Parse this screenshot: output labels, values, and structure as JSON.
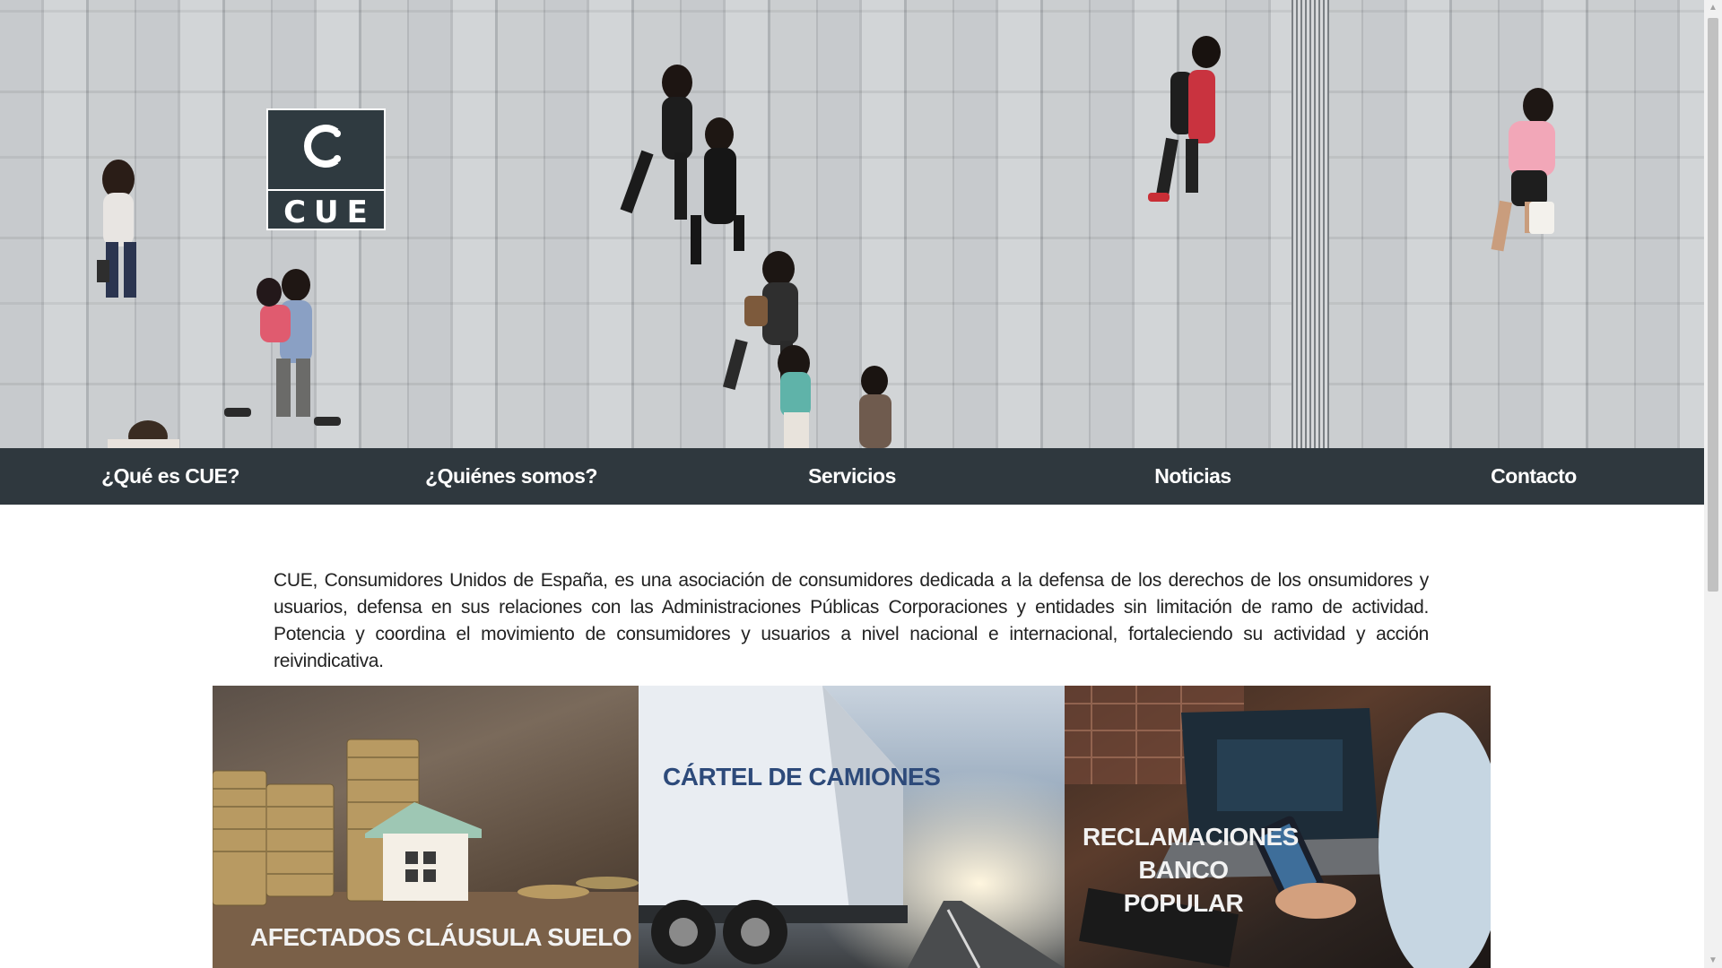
{
  "logo": {
    "text": "CUE"
  },
  "nav": {
    "items": [
      {
        "label": "¿Qué es CUE?"
      },
      {
        "label": "¿Quiénes somos?"
      },
      {
        "label": "Servicios"
      },
      {
        "label": "Noticias"
      },
      {
        "label": "Contacto"
      }
    ]
  },
  "intro": {
    "text": "CUE, Consumidores Unidos de España, es una asociación de consumidores dedicada a la defensa de los derechos de los onsumidores y usuarios, defensa en sus relaciones con las Administraciones Públicas Corporaciones y entidades sin limitación de ramo de actividad. Potencia y coordina el movimiento de consumidores y usuarios a nivel nacional e internacional, fortaleciendo su actividad y acción reivindicativa."
  },
  "cards": [
    {
      "title": "AFECTADOS CLÁUSULA SUELO",
      "image": "coins-and-house"
    },
    {
      "title": "CÁRTEL DE CAMIONES",
      "image": "truck-on-road"
    },
    {
      "title": "RECLAMACIONES BANCO POPULAR",
      "image": "person-with-phone-and-laptop"
    }
  ],
  "colors": {
    "nav_bg": "#2f383e",
    "logo_bg": "#2f3a40",
    "card2_title": "#2d4a7a",
    "text": "#222222"
  }
}
